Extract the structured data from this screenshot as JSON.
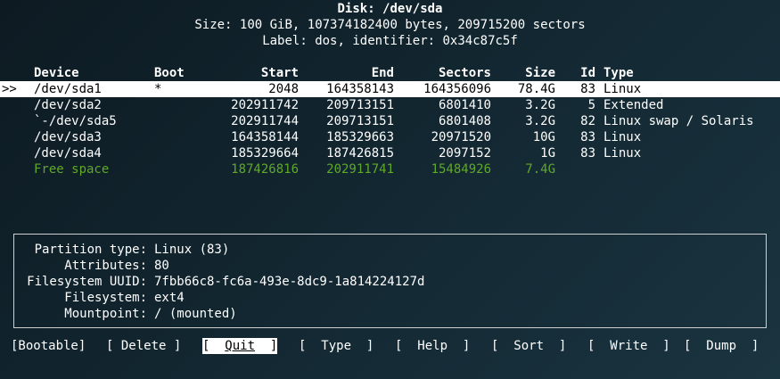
{
  "disk": {
    "title": "Disk: /dev/sda",
    "size_line": "Size: 100 GiB, 107374182400 bytes, 209715200 sectors",
    "label_line": "Label: dos, identifier: 0x34c87c5f"
  },
  "table": {
    "headers": {
      "device": "Device",
      "boot": "Boot",
      "start": "Start",
      "end": "End",
      "sectors": "Sectors",
      "size": "Size",
      "id": "Id",
      "type": "Type"
    },
    "cursor": ">>",
    "rows": [
      {
        "device": "/dev/sda1",
        "boot": "*",
        "start": "2048",
        "end": "164358143",
        "sectors": "164356096",
        "size": "78.4G",
        "id": "83",
        "type": "Linux"
      },
      {
        "device": "/dev/sda2",
        "boot": "",
        "start": "202911742",
        "end": "209713151",
        "sectors": "6801410",
        "size": "3.2G",
        "id": "5",
        "type": "Extended"
      },
      {
        "device": "`-/dev/sda5",
        "boot": "",
        "start": "202911744",
        "end": "209713151",
        "sectors": "6801408",
        "size": "3.2G",
        "id": "82",
        "type": "Linux swap / Solaris"
      },
      {
        "device": "/dev/sda3",
        "boot": "",
        "start": "164358144",
        "end": "185329663",
        "sectors": "20971520",
        "size": "10G",
        "id": "83",
        "type": "Linux"
      },
      {
        "device": "/dev/sda4",
        "boot": "",
        "start": "185329664",
        "end": "187426815",
        "sectors": "2097152",
        "size": "1G",
        "id": "83",
        "type": "Linux"
      },
      {
        "device": "Free space",
        "boot": "",
        "start": "187426816",
        "end": "202911741",
        "sectors": "15484926",
        "size": "7.4G",
        "id": "",
        "type": ""
      }
    ]
  },
  "info": [
    {
      "label": "Partition type:",
      "value": "Linux (83)"
    },
    {
      "label": "Attributes:",
      "value": "80"
    },
    {
      "label": "Filesystem UUID:",
      "value": "7fbb66c8-fc6a-493e-8dc9-1a814224127d"
    },
    {
      "label": "Filesystem:",
      "value": "ext4"
    },
    {
      "label": "Mountpoint:",
      "value": "/ (mounted)"
    }
  ],
  "menu": {
    "bootable": "[Bootable]",
    "delete": "[ Delete ]",
    "quit": "Quit",
    "quit_left": "[  ",
    "quit_right": "  ]",
    "type": "[  Type  ]",
    "help": "[  Help  ]",
    "sort": "[  Sort  ]",
    "write": "[  Write  ]",
    "dump": "[  Dump  ]"
  },
  "colors": {
    "free_space": "#5fa82a",
    "selected_bg": "#ffffff",
    "background": "#122630"
  }
}
